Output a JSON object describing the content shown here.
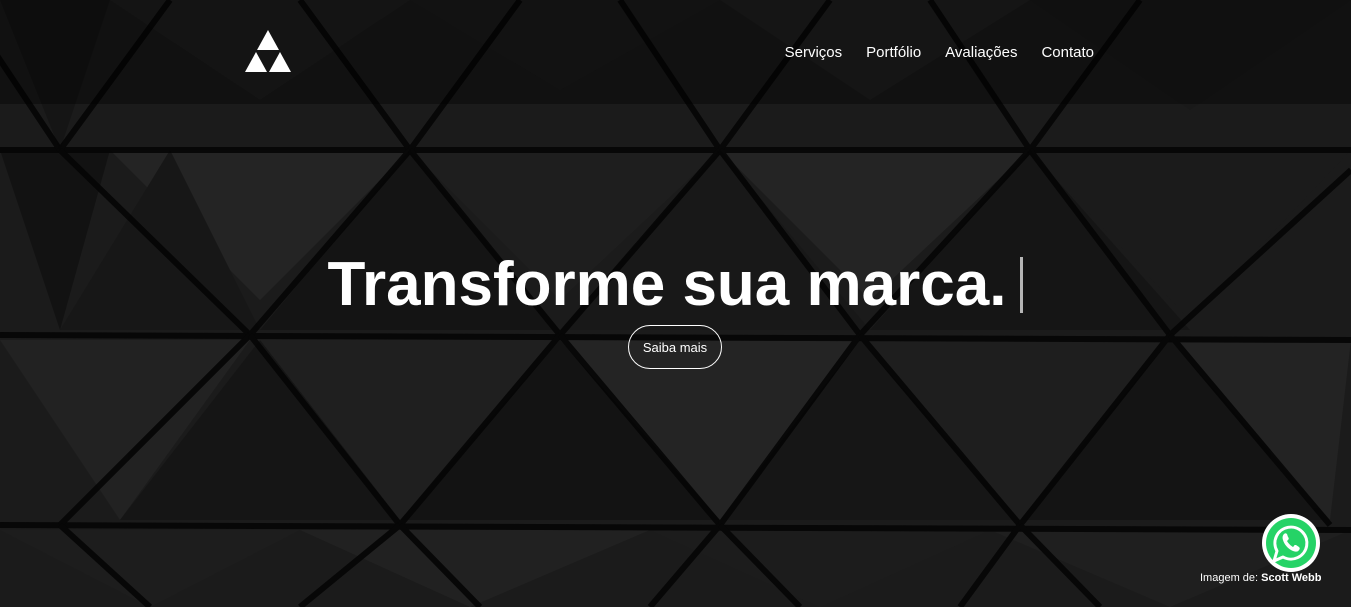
{
  "nav": {
    "items": [
      {
        "label": "Serviços"
      },
      {
        "label": "Portfólio"
      },
      {
        "label": "Avaliações"
      },
      {
        "label": "Contato"
      }
    ]
  },
  "hero": {
    "headline": "Transforme sua marca.",
    "cta_label": "Saiba mais"
  },
  "credit": {
    "prefix": "Imagem de:",
    "author": "Scott Webb"
  },
  "icons": {
    "logo": "triforce-logo-icon",
    "whatsapp": "whatsapp-icon"
  },
  "colors": {
    "background": "#141414",
    "text": "#ffffff",
    "whatsapp_green": "#25d366"
  }
}
